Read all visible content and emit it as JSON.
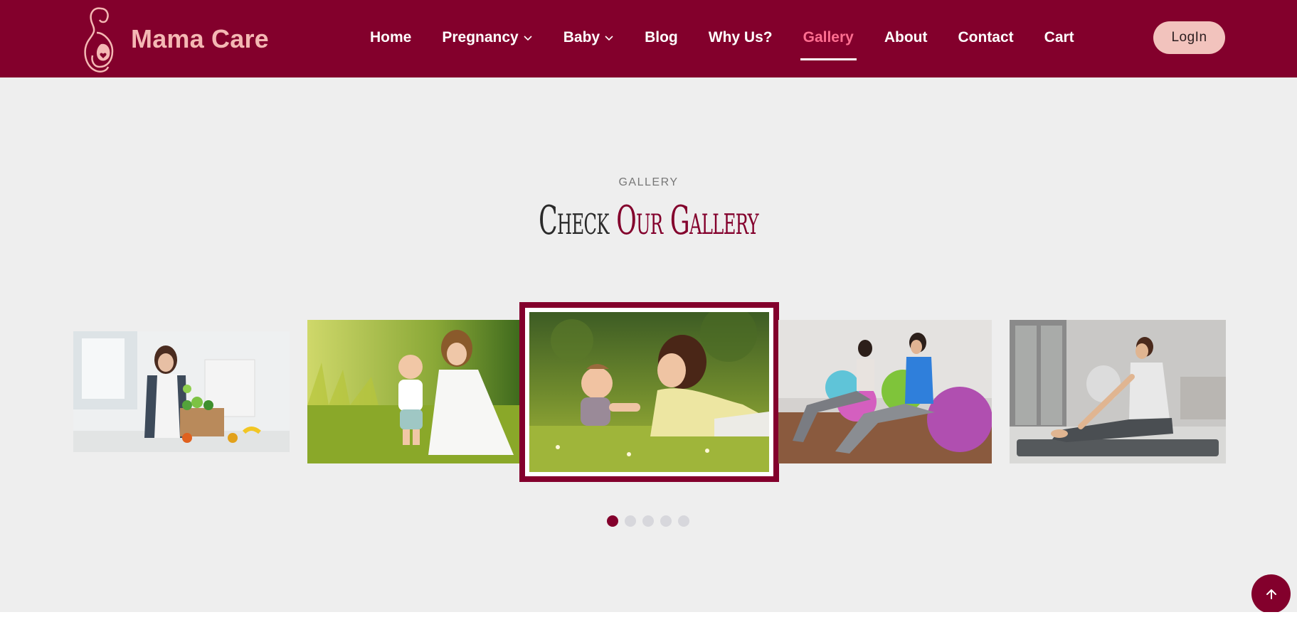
{
  "brand": {
    "name": "Mama Care",
    "logo_icon": "pregnant-woman-silhouette-icon",
    "colors": {
      "primary": "#83002c",
      "logo_text": "#f4b8b4",
      "active_nav": "#ff6f91",
      "login_bg": "#f2c3bd"
    }
  },
  "nav": {
    "items": [
      {
        "label": "Home"
      },
      {
        "label": "Pregnancy",
        "dropdown": true
      },
      {
        "label": "Baby",
        "dropdown": true
      },
      {
        "label": "Blog"
      },
      {
        "label": "Why Us?"
      },
      {
        "label": "Gallery",
        "active": true
      },
      {
        "label": "About"
      },
      {
        "label": "Contact"
      },
      {
        "label": "Cart"
      }
    ],
    "login_label": "LogIn"
  },
  "gallery": {
    "label": "GALLERY",
    "title_part1": "Check ",
    "title_part2": "Our Gallery",
    "slides": [
      {
        "subject": "pregnant woman in kitchen with groceries"
      },
      {
        "subject": "mother and baby walking in sunny grass"
      },
      {
        "subject": "mother lying in grass with baby",
        "active": true
      },
      {
        "subject": "pregnant women exercising on fitness balls"
      },
      {
        "subject": "pregnant woman stretching on yoga mat"
      }
    ],
    "pagination": {
      "count": 5,
      "active_index": 0
    }
  },
  "scroll_top_icon": "arrow-up-icon"
}
